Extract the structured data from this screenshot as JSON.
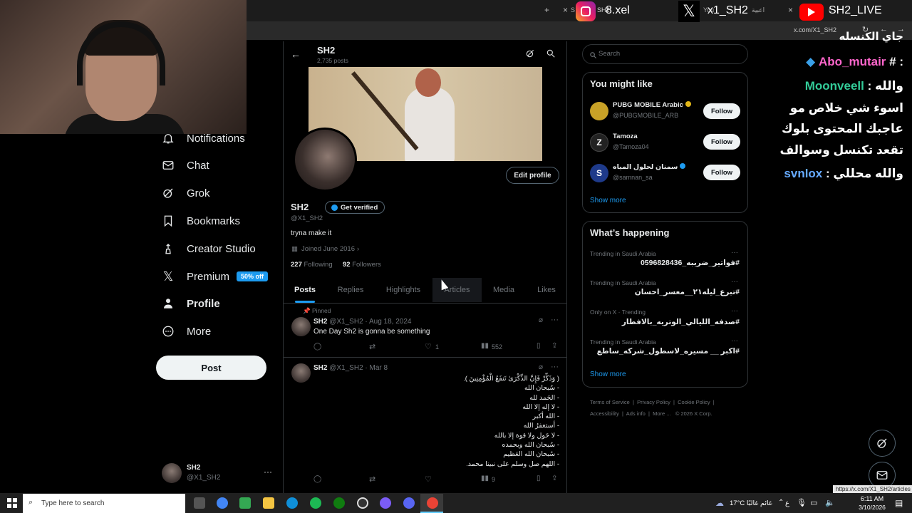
{
  "browser": {
    "tabs": [
      {
        "label": "S"
      },
      {
        "label": "SH2"
      },
      {
        "label": "You"
      },
      {
        "label": "اعبية"
      },
      {
        "label": "c"
      }
    ],
    "url": "x.com/X1_SH2",
    "status_url": "https://x.com/X1_SH2/articles"
  },
  "stream_overlay": {
    "instagram": "8.xel",
    "x_handle": "x1_SH2",
    "youtube": "SH2_LIVE"
  },
  "nav": {
    "items": [
      {
        "label": "Notifications",
        "icon": "bell-icon"
      },
      {
        "label": "Chat",
        "icon": "mail-icon"
      },
      {
        "label": "Grok",
        "icon": "grok-icon"
      },
      {
        "label": "Bookmarks",
        "icon": "bookmark-icon"
      },
      {
        "label": "Creator Studio",
        "icon": "creator-studio-icon"
      },
      {
        "label": "Premium",
        "icon": "x-logo-icon"
      },
      {
        "label": "Profile",
        "icon": "person-icon"
      },
      {
        "label": "More",
        "icon": "more-circle-icon"
      }
    ],
    "premium_badge": "50% off",
    "post_button": "Post",
    "account": {
      "name": "SH2",
      "handle": "@X1_SH2"
    }
  },
  "profile": {
    "header_name": "SH2",
    "post_count": "2,735 posts",
    "edit_button": "Edit profile",
    "name": "SH2",
    "get_verified": "Get verified",
    "handle": "@X1_SH2",
    "bio": "tryna make it",
    "joined": "Joined June 2016",
    "following_count": "227",
    "following_label": "Following",
    "followers_count": "92",
    "followers_label": "Followers",
    "tabs": [
      "Posts",
      "Replies",
      "Highlights",
      "Articles",
      "Media",
      "Likes"
    ]
  },
  "tweets": [
    {
      "pinned": "Pinned",
      "name": "SH2",
      "meta": "@X1_SH2 · Aug 18, 2024",
      "text": "One Day Sh2 is gonna be something",
      "likes": "1",
      "views": "552"
    },
    {
      "name": "SH2",
      "meta": "@X1_SH2 · Mar 8",
      "lines": [
        "( وَذَكِّرْ فَإِنَّ الذِّكْرَىٰ تَنفَعُ الْمُؤْمِنِينَ ).",
        "- سُبحان الله",
        "- الحَمد لله",
        "- لا إله إلا الله",
        "- الله أكبر",
        "- أستغفرُ الله",
        "- لا حَول ولا قوة إلا بالله",
        "- سُبحان الله وبحمده",
        "- سُبحان الله العَظيم",
        "- اللهم صل وسلم على نبينا محمد."
      ],
      "views": "9"
    }
  ],
  "right": {
    "search_placeholder": "Search",
    "you_might_like_title": "You might like",
    "suggestions": [
      {
        "name": "PUBG MOBILE Arabic",
        "handle": "@PUBGMOBILE_ARB",
        "follow": "Follow",
        "color": "#c9a227"
      },
      {
        "name": "Tamoza",
        "handle": "@Tamoza04",
        "follow": "Follow",
        "color": "#222222"
      },
      {
        "name": "سمنان لحلول المياه",
        "handle": "@samnan_sa",
        "follow": "Follow",
        "color": "#1e3a8a"
      }
    ],
    "show_more": "Show more",
    "happening_title": "What’s happening",
    "trends": [
      {
        "meta": "Trending in Saudi Arabia",
        "title": "#فواتير_ضريبه_0596828436"
      },
      {
        "meta": "Trending in Saudi Arabia",
        "title": "#تبرع_ليله٢١__معسر_احسان"
      },
      {
        "meta": "Only on X · Trending",
        "title": "#صدفه_الليالي_الوتريه_بالافطار"
      },
      {
        "meta": "Trending in Saudi Arabia",
        "title": "#اكبر __ مسيره_لاسطول_شركه_ساطع"
      }
    ],
    "show_more_2": "Show more",
    "footer": [
      "Terms of Service",
      "Privacy Policy",
      "Cookie Policy",
      "Accessibility",
      "Ads info",
      "More ...",
      "© 2026 X Corp."
    ]
  },
  "chat": {
    "l1": "جاي الكنسله",
    "l2_name": "Abo_mutair",
    "l2_suffix": ": #",
    "l3_pre": "والله :",
    "l3_name": "Moonveell",
    "l4": "اسوء شي خلاص مو",
    "l5": "عاجبك المحتوى بلوك",
    "l6": "تقعد تكنسل وسوالف",
    "l7_pre": "والله محللي :",
    "l7_name": "svnlox"
  },
  "taskbar": {
    "search": "Type here to search",
    "weather": "17°C  غائم غالبًا",
    "lang": "ع",
    "time": "6:11 AM",
    "date": "3/10/2026"
  },
  "colors": {
    "accent": "#1d9bf0",
    "background": "#000000",
    "chat_abo": "#ff66cc",
    "chat_moon": "#33cc99",
    "chat_svn": "#66aaff"
  }
}
